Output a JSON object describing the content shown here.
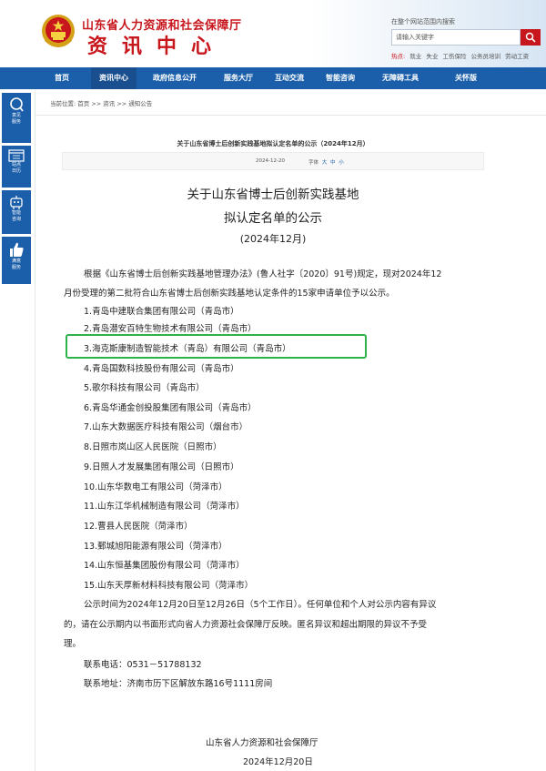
{
  "header": {
    "site_name": "山东省人力资源和社会保障厅",
    "site_sub": "资讯中心",
    "search_hint": "在整个网站范围内搜索",
    "search_placeholder": "请输入关键字",
    "hot_label": "热点:",
    "hot_words": [
      "就业",
      "失业",
      "工伤保险",
      "公务员培训",
      "劳动工资"
    ]
  },
  "nav": {
    "items": [
      "首页",
      "资讯中心",
      "政府信息公开",
      "服务大厅",
      "互动交流",
      "智能咨询",
      "无障碍工具",
      "关怀版"
    ],
    "active_index": 1
  },
  "sidebar": {
    "items": [
      {
        "label1": "意见",
        "label2": "服务",
        "icon": "search-icon"
      },
      {
        "label1": "站点",
        "label2": "日历",
        "icon": "calendar-icon"
      },
      {
        "label1": "智能",
        "label2": "咨询",
        "icon": "robot-icon"
      },
      {
        "label1": "满意",
        "label2": "服务",
        "icon": "thumbs-up-icon"
      }
    ]
  },
  "breadcrumb": "当前位置: 首页 >> 资讯 >> 通知公告",
  "article": {
    "small_title": "关于山东省博士后创新实践基地拟认定名单的公示（2024年12月）",
    "date": "2024-12-20",
    "size_label": "字体",
    "sizes": [
      "大",
      "中",
      "小"
    ],
    "title_line1": "关于山东省博士后创新实践基地",
    "title_line2": "拟认定名单的公示",
    "title_line3": "(2024年12月)",
    "intro_line1": "根据《山东省博士后创新实践基地管理办法》(鲁人社字〔2020〕91号)规定，现对2024年12",
    "intro_line2": "月份受理的第二批符合山东省博士后创新实践基地认定条件的15家申请单位予以公示。",
    "list": [
      "1.青岛中建联合集团有限公司（青岛市）",
      "2.青岛潜安百特生物技术有限公司（青岛市）",
      "3.海克斯康制造智能技术（青岛）有限公司（青岛市）",
      "4.青岛国数科技股份有限公司（青岛市）",
      "5.歌尔科技有限公司（青岛市）",
      "6.青岛华通金创投股集团有限公司（青岛市）",
      "7.山东大数据医疗科技有限公司（烟台市）",
      "8.日照市岚山区人民医院（日照市）",
      "9.日照人才发展集团有限公司（日照市）",
      "10.山东华数电工有限公司（菏泽市）",
      "11.山东江华机械制造有限公司（菏泽市）",
      "12.曹县人民医院（菏泽市）",
      "13.鄄城旭阳能源有限公司（菏泽市）",
      "14.山东恒基集团股份有限公司（菏泽市）",
      "15.山东天厚新材料科技有限公司（菏泽市）"
    ],
    "notice_line1": "公示时间为2024年12月20日至12月26日（5个工作日）。任何单位和个人对公示内容有异议",
    "notice_line2": "的，请在公示期内以书面形式向省人力资源社会保障厅反映。匿名异议和超出期限的异议不予受",
    "notice_line3": "理。",
    "contact_phone": "联系电话：0531－51788132",
    "contact_address": "联系地址：济南市历下区解放东路16号1111房间",
    "sign_org": "山东省人力资源和社会保障厅",
    "sign_date": "2024年12月20日"
  },
  "colors": {
    "brand_red": "#c8161d",
    "nav_blue": "#1b5faa",
    "highlight_green": "#2db34a"
  }
}
